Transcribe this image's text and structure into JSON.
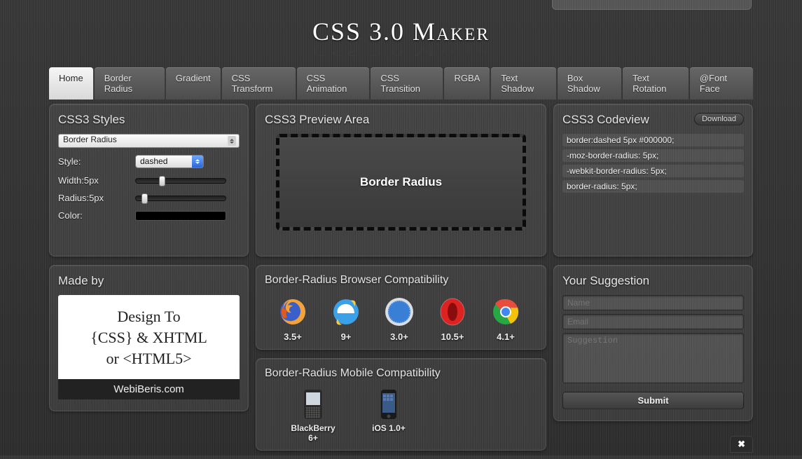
{
  "site_title": "CSS 3.0 Maker",
  "nav": [
    {
      "label": "Home",
      "active": true
    },
    {
      "label": "Border Radius"
    },
    {
      "label": "Gradient"
    },
    {
      "label": "CSS Transform"
    },
    {
      "label": "CSS Animation"
    },
    {
      "label": "CSS Transition"
    },
    {
      "label": "RGBA"
    },
    {
      "label": "Text Shadow"
    },
    {
      "label": "Box Shadow"
    },
    {
      "label": "Text Rotation"
    },
    {
      "label": "@Font Face"
    }
  ],
  "styles_panel": {
    "title": "CSS3 Styles",
    "feature_select": "Border Radius",
    "rows": {
      "style": {
        "label": "Style:",
        "value": "dashed"
      },
      "width": {
        "label": "Width:5px"
      },
      "radius": {
        "label": "Radius:5px"
      },
      "color": {
        "label": "Color:",
        "value": "#000000"
      }
    }
  },
  "preview": {
    "title": "CSS3 Preview Area",
    "text": "Border Radius"
  },
  "codeview": {
    "title": "CSS3 Codeview",
    "download": "Download",
    "lines": [
      "border:dashed 5px #000000;",
      "-moz-border-radius: 5px;",
      "-webkit-border-radius: 5px;",
      "border-radius: 5px;"
    ]
  },
  "madeby": {
    "title": "Made by",
    "lines": [
      "Design To",
      "{CSS} & XHTML",
      "or  <HTML5>"
    ],
    "site": "WebiBeris.com"
  },
  "browser_compat": {
    "title": "Border-Radius Browser Compatibility",
    "items": [
      {
        "name": "Firefox",
        "label": "3.5+"
      },
      {
        "name": "Internet Explorer",
        "label": "9+"
      },
      {
        "name": "Safari",
        "label": "3.0+"
      },
      {
        "name": "Opera",
        "label": "10.5+"
      },
      {
        "name": "Chrome",
        "label": "4.1+"
      }
    ]
  },
  "mobile_compat": {
    "title": "Border-Radius Mobile Compatibility",
    "items": [
      {
        "name": "BlackBerry",
        "label": "BlackBerry 6+"
      },
      {
        "name": "iOS",
        "label": "iOS 1.0+"
      }
    ]
  },
  "suggestion": {
    "title": "Your Suggestion",
    "name_ph": "Name",
    "email_ph": "Email",
    "msg_ph": "Suggestion",
    "submit": "Submit"
  },
  "close": "✖"
}
